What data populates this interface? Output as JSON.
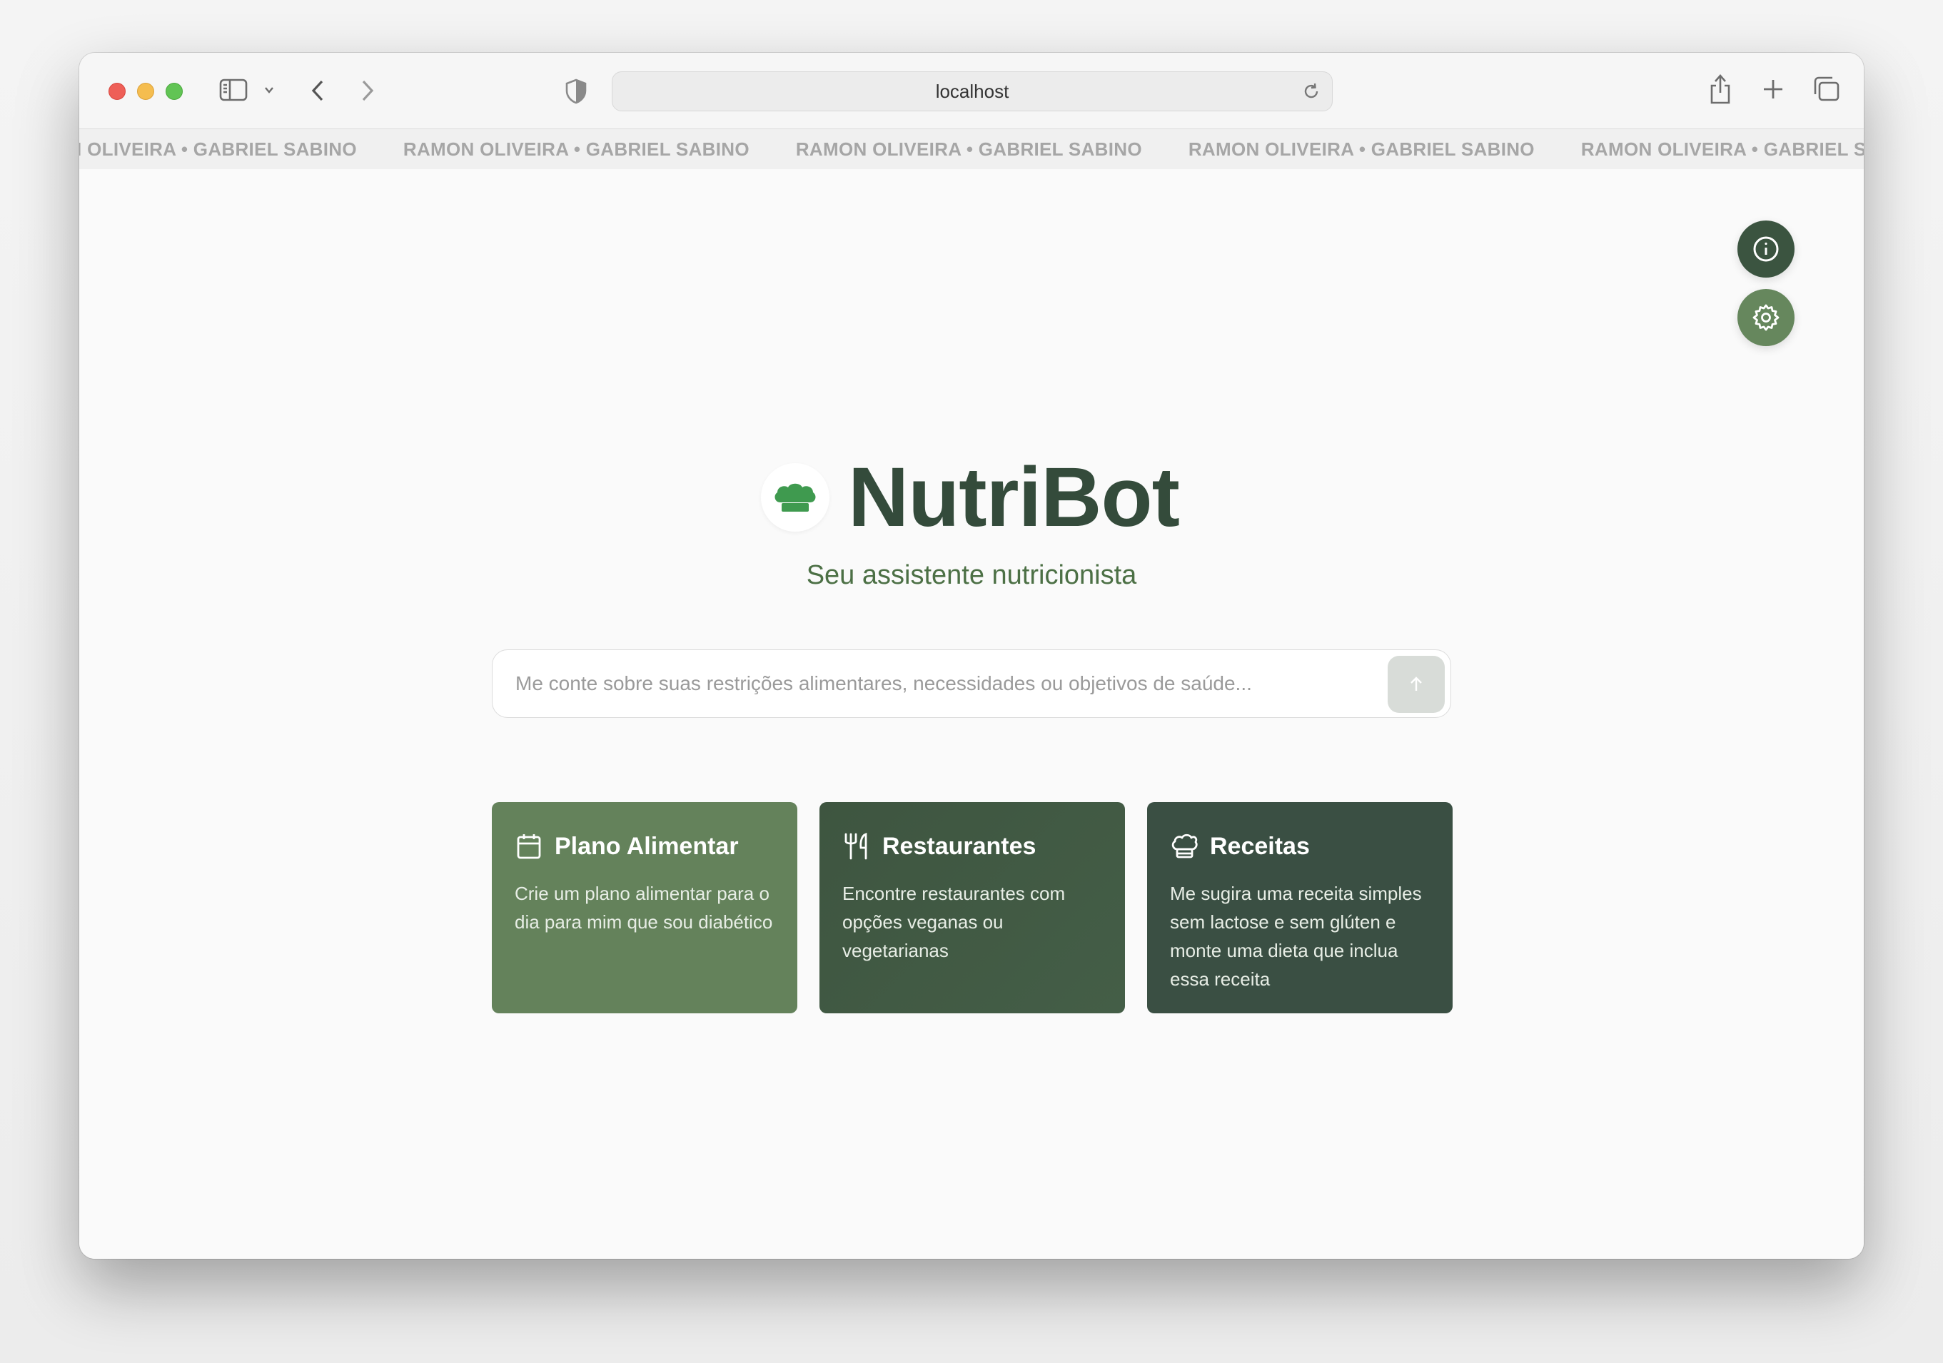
{
  "browser": {
    "address": "localhost"
  },
  "marquee": {
    "items": [
      "ON OLIVEIRA • GABRIEL SABINO",
      "RAMON OLIVEIRA • GABRIEL SABINO",
      "RAMON OLIVEIRA • GABRIEL SABINO",
      "RAMON OLIVEIRA • GABRIEL SABINO",
      "RAMON OLIVEIRA • GABRIEL SABINO"
    ]
  },
  "app": {
    "title": "NutriBot",
    "subtitle": "Seu assistente nutricionista",
    "search_placeholder": "Me conte sobre suas restrições alimentares, necessidades ou objetivos de saúde..."
  },
  "cards": [
    {
      "icon": "calendar-icon",
      "title": "Plano Alimentar",
      "description": "Crie um plano alimentar para o dia para mim que sou diabético"
    },
    {
      "icon": "utensils-icon",
      "title": "Restaurantes",
      "description": "Encontre restaurantes com opções veganas ou vegetarianas"
    },
    {
      "icon": "chef-hat-icon",
      "title": "Receitas",
      "description": "Me sugira uma receita simples sem lactose e sem glúten e monte uma dieta que inclua essa receita"
    }
  ],
  "colors": {
    "brand_dark": "#344b3b",
    "brand_green": "#4c7045",
    "card_light": "#64825b",
    "card_mid": "#415a44",
    "card_dark": "#3a4f43",
    "logo_green": "#3f9a4f"
  }
}
